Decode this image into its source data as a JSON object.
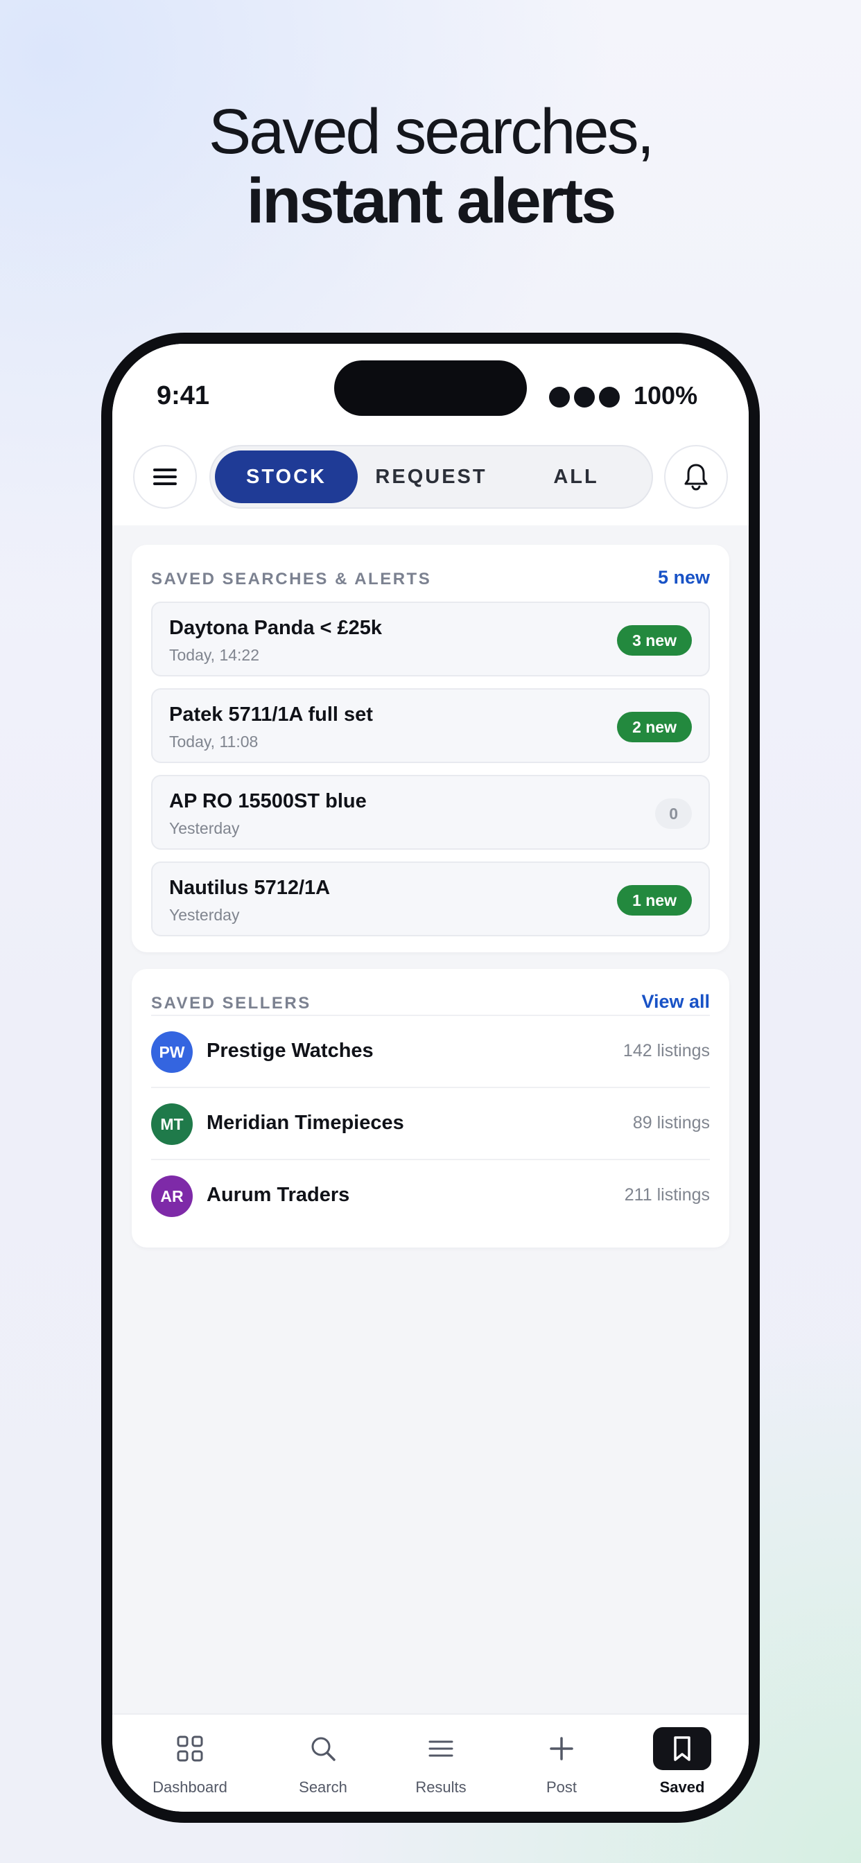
{
  "headline": {
    "line1": "Saved searches,",
    "line2": "instant alerts"
  },
  "status_bar": {
    "time": "9:41",
    "battery": "100%"
  },
  "header": {
    "segments": [
      {
        "label": "STOCK",
        "active": true
      },
      {
        "label": "REQUEST",
        "active": false
      },
      {
        "label": "ALL",
        "active": false
      }
    ],
    "menu_icon": "hamburger-icon",
    "bell_icon": "bell-icon"
  },
  "saved_searches": {
    "title": "SAVED SEARCHES & ALERTS",
    "link": "5 new",
    "items": [
      {
        "title": "Daytona Panda < £25k",
        "time": "Today, 14:22",
        "badge": "3 new"
      },
      {
        "title": "Patek 5711/1A full set",
        "time": "Today, 11:08",
        "badge": "2 new"
      },
      {
        "title": "AP RO 15500ST blue",
        "time": "Yesterday",
        "badge": "0"
      },
      {
        "title": "Nautilus 5712/1A",
        "time": "Yesterday",
        "badge": "1 new"
      }
    ]
  },
  "saved_sellers": {
    "title": "SAVED SELLERS",
    "link": "View all",
    "items": [
      {
        "initials": "PW",
        "name": "Prestige Watches",
        "count": "142 listings",
        "color": "#3465e0"
      },
      {
        "initials": "MT",
        "name": "Meridian Timepieces",
        "count": "89 listings",
        "color": "#1f7a4a"
      },
      {
        "initials": "AR",
        "name": "Aurum Traders",
        "count": "211 listings",
        "color": "#7e2aa8"
      }
    ]
  },
  "tabbar": {
    "tabs": [
      {
        "label": "Dashboard",
        "icon": "grid-icon"
      },
      {
        "label": "Search",
        "icon": "search-icon"
      },
      {
        "label": "Results",
        "icon": "list-icon"
      },
      {
        "label": "Post",
        "icon": "plus-icon"
      },
      {
        "label": "Saved",
        "icon": "bookmark-icon",
        "active": true
      }
    ]
  },
  "colors": {
    "accent": "#1f3b96",
    "link": "#1852c6",
    "badge_green": "#23893e"
  }
}
